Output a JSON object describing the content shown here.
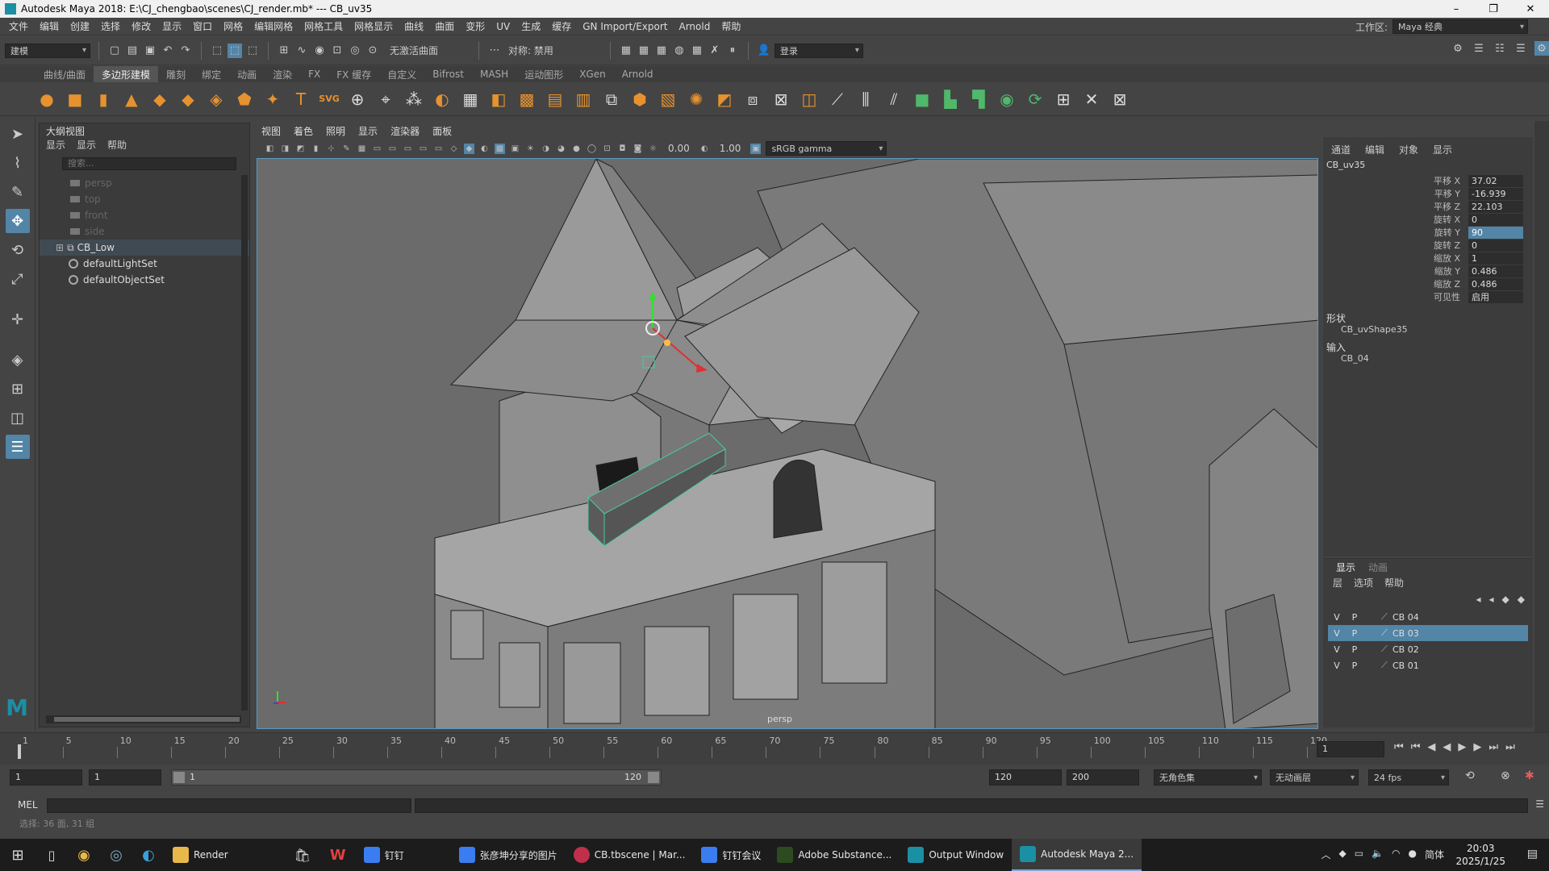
{
  "titlebar": {
    "title": "Autodesk Maya 2018: E:\\CJ_chengbao\\scenes\\CJ_render.mb*   ---   CB_uv35",
    "minimize": "–",
    "restore": "❐",
    "close": "✕"
  },
  "menubar": {
    "items": [
      "文件",
      "编辑",
      "创建",
      "选择",
      "修改",
      "显示",
      "窗口",
      "网格",
      "编辑网格",
      "网格工具",
      "网格显示",
      "曲线",
      "曲面",
      "变形",
      "UV",
      "生成",
      "缓存",
      "GN Import/Export",
      "Arnold",
      "帮助"
    ],
    "workspace_label": "工作区:",
    "workspace_value": "Maya 经典"
  },
  "statusline": {
    "mode": "建模",
    "live_surface": "无激活曲面",
    "symmetry": "对称: 禁用",
    "login": "登录"
  },
  "shelf_tabs": [
    "曲线/曲面",
    "多边形建模",
    "雕刻",
    "绑定",
    "动画",
    "渲染",
    "FX",
    "FX 缓存",
    "自定义",
    "Bifrost",
    "MASH",
    "运动图形",
    "XGen",
    "Arnold"
  ],
  "shelf_active": "多边形建模",
  "outliner": {
    "title": "大纲视图",
    "menu": [
      "显示",
      "显示",
      "帮助"
    ],
    "search_placeholder": "搜索...",
    "items": [
      {
        "label": "persp",
        "dim": true
      },
      {
        "label": "top",
        "dim": true
      },
      {
        "label": "front",
        "dim": true
      },
      {
        "label": "side",
        "dim": true
      },
      {
        "label": "CB_Low",
        "dim": false
      },
      {
        "label": "defaultLightSet",
        "dim": false
      },
      {
        "label": "defaultObjectSet",
        "dim": false
      }
    ]
  },
  "viewport": {
    "menu": [
      "视图",
      "着色",
      "照明",
      "显示",
      "渲染器",
      "面板"
    ],
    "exposure": "0.00",
    "gamma": "1.00",
    "colorspace": "sRGB gamma",
    "camera_label": "persp"
  },
  "channel_box": {
    "menu": [
      "通道",
      "编辑",
      "对象",
      "显示"
    ],
    "object": "CB_uv35",
    "attributes": [
      {
        "label": "平移 X",
        "value": "37.02"
      },
      {
        "label": "平移 Y",
        "value": "-16.939"
      },
      {
        "label": "平移 Z",
        "value": "22.103"
      },
      {
        "label": "旋转 X",
        "value": "0"
      },
      {
        "label": "旋转 Y",
        "value": "90"
      },
      {
        "label": "旋转 Z",
        "value": "0"
      },
      {
        "label": "缩放 X",
        "value": "1"
      },
      {
        "label": "缩放 Y",
        "value": "0.486"
      },
      {
        "label": "缩放 Z",
        "value": "0.486"
      },
      {
        "label": "可见性",
        "value": "启用"
      }
    ],
    "highlighted_attr": "旋转 Y",
    "shapes_label": "形状",
    "shape_name": "CB_uvShape35",
    "inputs_label": "输入",
    "input_name": "CB_04"
  },
  "layer_editor": {
    "tabs": [
      "显示",
      "动画"
    ],
    "menu": [
      "层",
      "选项",
      "帮助"
    ],
    "layers": [
      {
        "v": "V",
        "p": "P",
        "name": "CB 04",
        "selected": false
      },
      {
        "v": "V",
        "p": "P",
        "name": "CB 03",
        "selected": true
      },
      {
        "v": "V",
        "p": "P",
        "name": "CB 02",
        "selected": false
      },
      {
        "v": "V",
        "p": "P",
        "name": "CB 01",
        "selected": false
      }
    ]
  },
  "timeline": {
    "ticks": [
      "1",
      "5",
      "10",
      "15",
      "20",
      "25",
      "30",
      "35",
      "40",
      "45",
      "50",
      "55",
      "60",
      "65",
      "70",
      "75",
      "80",
      "85",
      "90",
      "95",
      "100",
      "105",
      "110",
      "115",
      "120"
    ],
    "current_frame": "1",
    "range_start": "1",
    "range_inner_start": "1",
    "range_slider_start": "1",
    "range_slider_end": "120",
    "range_inner_end": "120",
    "range_end": "200",
    "character_set": "无角色集",
    "anim_layer": "无动画层",
    "fps": "24 fps"
  },
  "mel": {
    "label": "MEL"
  },
  "helpline": "选择: 36 面, 31 组",
  "taskbar": {
    "apps": [
      {
        "label": "Render",
        "color": "#e8b84a"
      },
      {
        "label": "钉钉",
        "color": "#3a7df0"
      },
      {
        "label": "张彦坤分享的图片",
        "color": "#3a7df0"
      },
      {
        "label": "CB.tbscene | Mar...",
        "color": "#c0304a"
      },
      {
        "label": "钉钉会议",
        "color": "#3a7df0"
      },
      {
        "label": "Adobe Substance...",
        "color": "#2d4a20"
      },
      {
        "label": "Output Window",
        "color": "#1b8fa3"
      },
      {
        "label": "Autodesk Maya 2...",
        "color": "#1b8fa3"
      }
    ],
    "ime": "简体",
    "time": "20:03",
    "date": "2025/1/25"
  }
}
